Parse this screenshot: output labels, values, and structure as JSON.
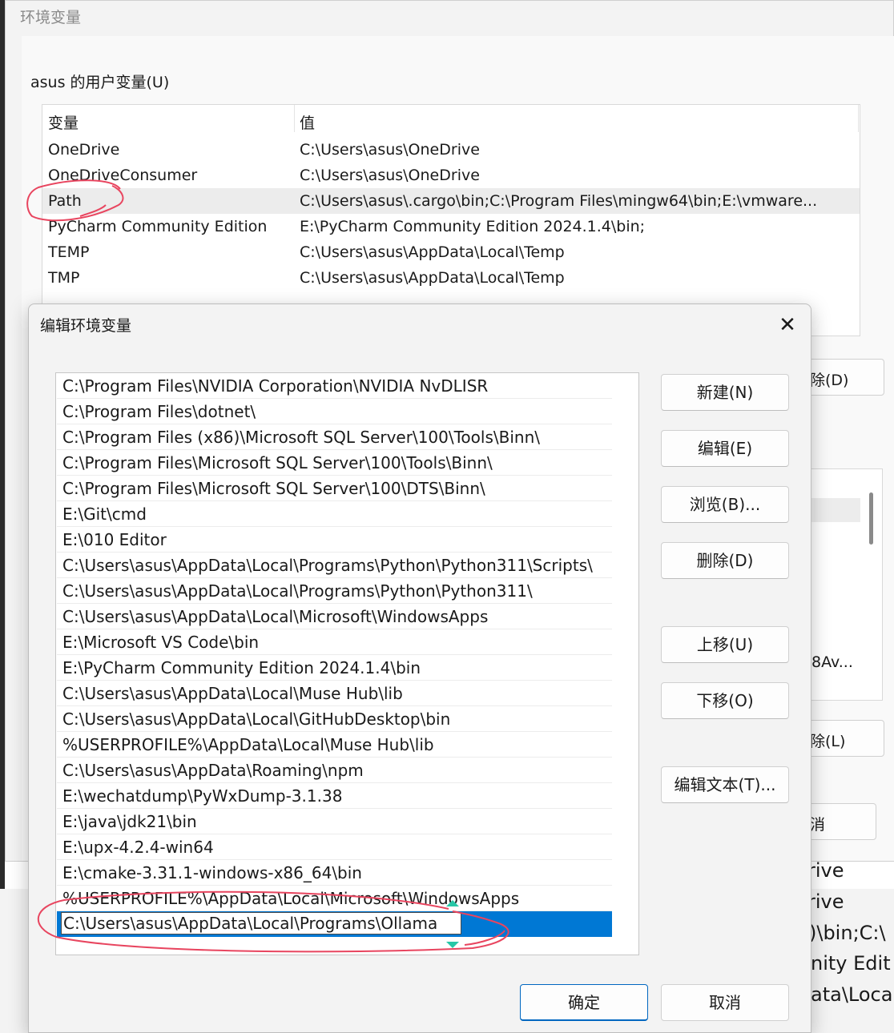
{
  "parent_dialog": {
    "title": "环境变量",
    "user_vars_label": "asus 的用户变量(U)",
    "columns": {
      "variable": "变量",
      "value": "值"
    },
    "user_vars": [
      {
        "name": "OneDrive",
        "value": "C:\\Users\\asus\\OneDrive",
        "selected": false
      },
      {
        "name": "OneDriveConsumer",
        "value": "C:\\Users\\asus\\OneDrive",
        "selected": false
      },
      {
        "name": "Path",
        "value": "C:\\Users\\asus\\.cargo\\bin;C:\\Program Files\\mingw64\\bin;E:\\vmware...",
        "selected": true
      },
      {
        "name": "PyCharm Community Edition",
        "value": "E:\\PyCharm Community Edition 2024.1.4\\bin;",
        "selected": false
      },
      {
        "name": "TEMP",
        "value": "C:\\Users\\asus\\AppData\\Local\\Temp",
        "selected": false
      },
      {
        "name": "TMP",
        "value": "C:\\Users\\asus\\AppData\\Local\\Temp",
        "selected": false
      }
    ],
    "peek": {
      "delete_user_label": "除(D)",
      "sys_value_fragment": "8Av...",
      "delete_sys_label": "除(L)",
      "cancel_label": "消"
    }
  },
  "background_terminal": {
    "lines": [
      "rive",
      "rive",
      ")\\bin;C:\\",
      "nity Edit",
      "ata\\Loca"
    ]
  },
  "edit_dialog": {
    "title": "编辑环境变量",
    "close_glyph": "✕",
    "entries": [
      "C:\\Program Files\\NVIDIA Corporation\\NVIDIA NvDLISR",
      "C:\\Program Files\\dotnet\\",
      "C:\\Program Files (x86)\\Microsoft SQL Server\\100\\Tools\\Binn\\",
      "C:\\Program Files\\Microsoft SQL Server\\100\\Tools\\Binn\\",
      "C:\\Program Files\\Microsoft SQL Server\\100\\DTS\\Binn\\",
      "E:\\Git\\cmd",
      "E:\\010 Editor",
      "C:\\Users\\asus\\AppData\\Local\\Programs\\Python\\Python311\\Scripts\\",
      "C:\\Users\\asus\\AppData\\Local\\Programs\\Python\\Python311\\",
      "C:\\Users\\asus\\AppData\\Local\\Microsoft\\WindowsApps",
      "E:\\Microsoft VS Code\\bin",
      "E:\\PyCharm Community Edition 2024.1.4\\bin",
      "C:\\Users\\asus\\AppData\\Local\\Muse Hub\\lib",
      "C:\\Users\\asus\\AppData\\Local\\GitHubDesktop\\bin",
      "%USERPROFILE%\\AppData\\Local\\Muse Hub\\lib",
      "C:\\Users\\asus\\AppData\\Roaming\\npm",
      "E:\\wechatdump\\PyWxDump-3.1.38",
      "E:\\java\\jdk21\\bin",
      "E:\\upx-4.2.4-win64",
      "E:\\cmake-3.31.1-windows-x86_64\\bin",
      "%USERPROFILE%\\AppData\\Local\\Microsoft\\WindowsApps"
    ],
    "editing_value": "C:\\Users\\asus\\AppData\\Local\\Programs\\Ollama",
    "buttons": {
      "new": "新建(N)",
      "edit": "编辑(E)",
      "browse": "浏览(B)...",
      "delete": "删除(D)",
      "move_up": "上移(U)",
      "move_down": "下移(O)",
      "edit_text": "编辑文本(T)...",
      "ok": "确定",
      "cancel": "取消"
    },
    "colors": {
      "selection": "#0078d4",
      "annotation": "#e8455f"
    }
  }
}
